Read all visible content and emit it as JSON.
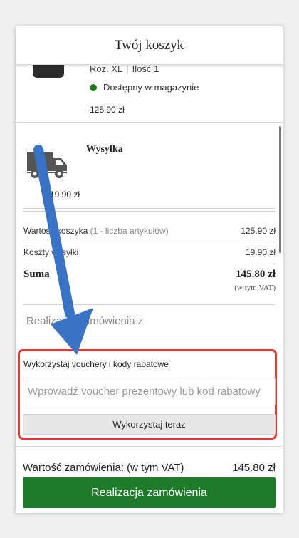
{
  "header": {
    "title": "Twój koszyk"
  },
  "product": {
    "size": "Roz. XL",
    "quantity": "Ilość 1",
    "availability": "Dostępny w magazynie",
    "availability_color": "#1f7a1f",
    "price": "125.90 zł"
  },
  "shipping": {
    "icon": "truck-icon",
    "title": "Wysyłka",
    "price": "19.90 zł"
  },
  "summary": {
    "cart_value_label": "Wartość koszyka",
    "cart_value_note": "(1 - liczba artykułów)",
    "cart_value": "125.90 zł",
    "shipping_cost_label": "Koszty wysyłki",
    "shipping_cost": "19.90 zł",
    "total_label": "Suma",
    "total_value": "145.80 zł",
    "total_vat_note": "(w tym VAT)"
  },
  "realize_from": "Realizacja zamówienia z",
  "voucher": {
    "title": "Wykorzystaj vouchery i kody rabatowe",
    "placeholder": "Wprowadź voucher prezentowy lub kod rabatowy",
    "button_label": "Wykorzystaj teraz",
    "highlight_color": "#e53935"
  },
  "footer": {
    "order_value_label": "Wartość zamówienia: (w tym VAT)",
    "order_value": "145.80 zł",
    "checkout_label": "Realizacja zamówienia",
    "checkout_color": "#1e7b2a"
  },
  "annotation": {
    "arrow_color": "#3b73c4"
  }
}
